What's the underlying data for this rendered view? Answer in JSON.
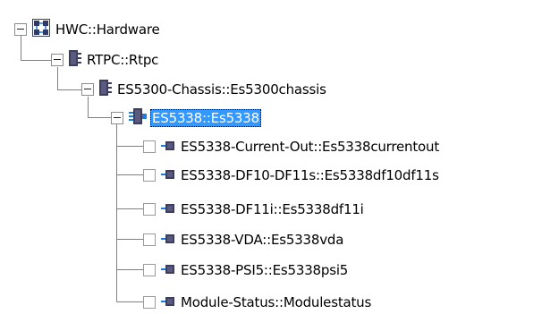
{
  "tree": {
    "root": {
      "label": "HWC::Hardware",
      "icon": "hardware-network-icon",
      "expanded": true
    },
    "rtpc": {
      "label": "RTPC::Rtpc",
      "icon": "rtpc-module-icon",
      "expanded": true
    },
    "chassis": {
      "label": "ES5300-Chassis::Es5300chassis",
      "icon": "chassis-module-icon",
      "expanded": true
    },
    "es5338": {
      "label": "ES5338::Es5338",
      "icon": "board-module-icon",
      "expanded": true,
      "selected": true
    },
    "children": [
      {
        "label": "ES5338-Current-Out::Es5338currentout",
        "icon": "submodule-icon"
      },
      {
        "label": "ES5338-DF10-DF11s::Es5338df10df11s",
        "icon": "submodule-icon"
      },
      {
        "label": "ES5338-DF11i::Es5338df11i",
        "icon": "submodule-icon"
      },
      {
        "label": "ES5338-VDA::Es5338vda",
        "icon": "submodule-icon"
      },
      {
        "label": "ES5338-PSI5::Es5338psi5",
        "icon": "submodule-icon"
      },
      {
        "label": "Module-Status::Modulestatus",
        "icon": "submodule-icon"
      }
    ]
  },
  "colors": {
    "selection": "#3399ff",
    "icon_dark": "#3d3d5c",
    "icon_blue": "#1e7be0",
    "connector": "#808080"
  }
}
